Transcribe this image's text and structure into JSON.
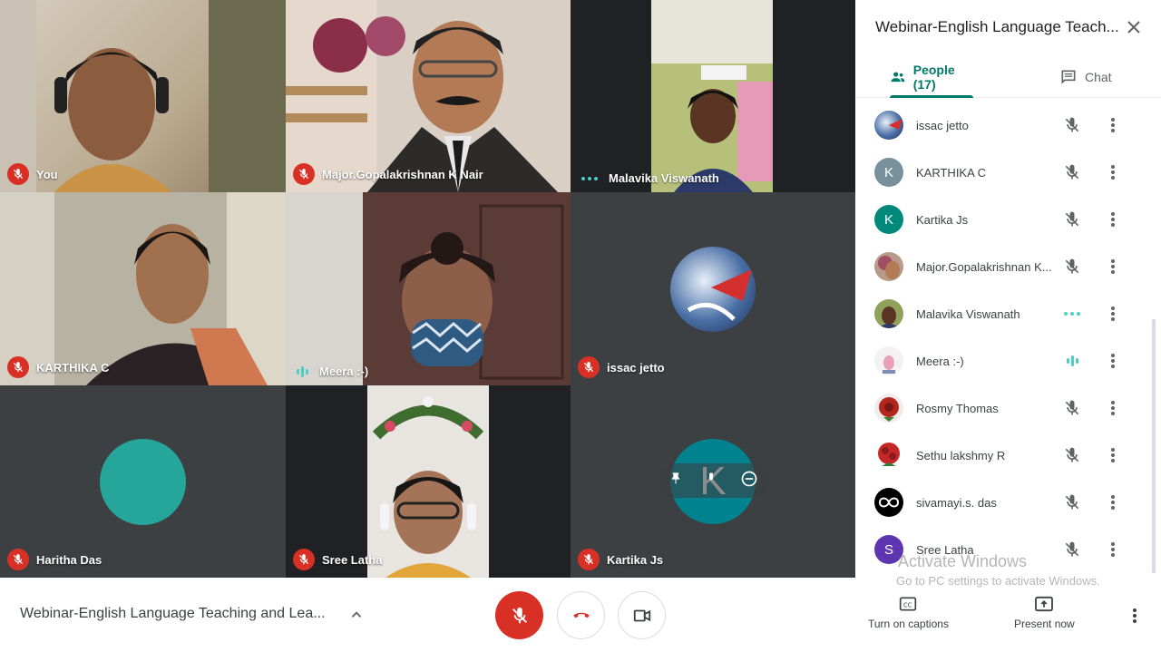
{
  "meeting": {
    "title": "Webinar-English Language Teaching and Lea...",
    "panel_title": "Webinar-English Language Teach..."
  },
  "tiles": [
    {
      "label": "You",
      "status": "muted"
    },
    {
      "label": "Major.Gopalakrishnan K Nair",
      "status": "muted"
    },
    {
      "label": "Malavika Viswanath",
      "status": "speaking-dots"
    },
    {
      "label": "KARTHIKA C",
      "status": "muted"
    },
    {
      "label": "Meera :-)",
      "status": "speaking-bars"
    },
    {
      "label": "issac jetto",
      "status": "muted"
    },
    {
      "label": "Haritha Das",
      "status": "muted"
    },
    {
      "label": "Sree Latha",
      "status": "muted"
    },
    {
      "label": "Kartika Js",
      "status": "muted",
      "avatar_letter": "K"
    }
  ],
  "tabs": {
    "people": "People (17)",
    "chat": "Chat"
  },
  "participants": [
    {
      "name": "issac jetto",
      "avatar": "image",
      "mic": "muted"
    },
    {
      "name": "KARTHIKA C",
      "avatar": "K",
      "avatar_color": "#78909c",
      "mic": "muted"
    },
    {
      "name": "Kartika Js",
      "avatar": "K",
      "avatar_color": "#00897b",
      "mic": "muted"
    },
    {
      "name": "Major.Gopalakrishnan K...",
      "avatar": "image",
      "mic": "muted"
    },
    {
      "name": "Malavika Viswanath",
      "avatar": "image",
      "mic": "speaking-dots"
    },
    {
      "name": "Meera :-)",
      "avatar": "image",
      "mic": "speaking-bars"
    },
    {
      "name": "Rosmy Thomas",
      "avatar": "image",
      "mic": "muted"
    },
    {
      "name": "Sethu lakshmy R",
      "avatar": "image",
      "mic": "muted"
    },
    {
      "name": "sivamayi.s. das",
      "avatar": "image",
      "mic": "muted"
    },
    {
      "name": "Sree Latha",
      "avatar": "S",
      "avatar_color": "#5e35b1",
      "mic": "muted"
    }
  ],
  "watermark": {
    "line1": "Activate Windows",
    "line2": "Go to PC settings to activate Windows."
  },
  "bottom": {
    "captions_label": "Turn on captions",
    "present_label": "Present now"
  },
  "colors": {
    "accent": "#00796b",
    "danger": "#d93025",
    "tile_bg": "#3c4043",
    "speaking": "#4ecdc4"
  }
}
